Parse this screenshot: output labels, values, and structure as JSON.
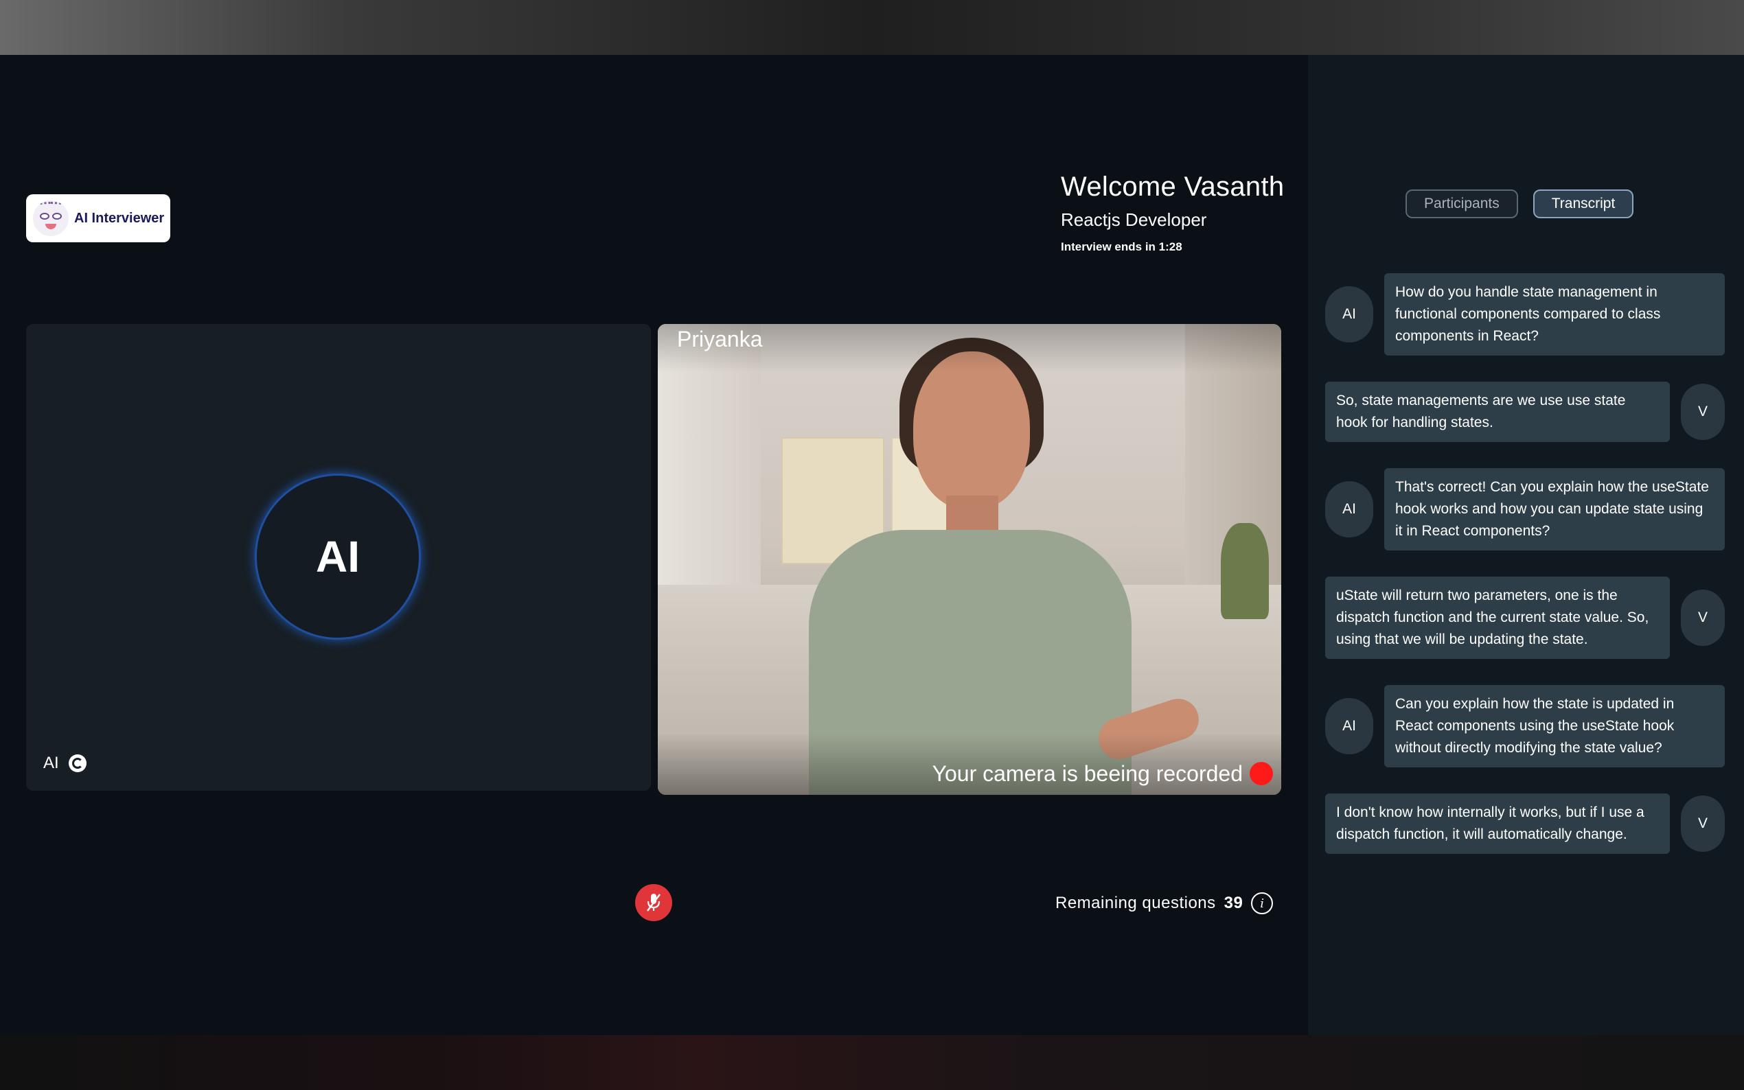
{
  "app": {
    "logo_text": "AI Interviewer"
  },
  "header": {
    "welcome": "Welcome Vasanth",
    "role": "Reactjs Developer",
    "timer": "Interview ends in 1:28"
  },
  "ai_tile": {
    "avatar_text": "AI",
    "label": "AI"
  },
  "video_tile": {
    "name": "Priyanka",
    "recording_text": "Your camera is beeing recorded"
  },
  "footer": {
    "remaining_label": "Remaining questions",
    "remaining_count": "39",
    "info_symbol": "i"
  },
  "sidebar": {
    "tabs": [
      {
        "label": "Participants",
        "active": false
      },
      {
        "label": "Transcript",
        "active": true
      }
    ],
    "transcript": [
      {
        "speaker": "AI",
        "text": "How do you handle state management in functional components compared to class components in React?"
      },
      {
        "speaker": "V",
        "text": "So, state managements are we use use state hook for handling states."
      },
      {
        "speaker": "AI",
        "text": "That's correct! Can you explain how the useState hook works and how you can update state using it in React components?"
      },
      {
        "speaker": "V",
        "text": "uState will return two parameters, one is the dispatch function and the current state value. So, using that we will be updating the state."
      },
      {
        "speaker": "AI",
        "text": "Can you explain how the state is updated in React components using the useState hook without directly modifying the state value?"
      },
      {
        "speaker": "V",
        "text": "I don't know how internally it works, but if I use a dispatch function, it will automatically change."
      }
    ]
  },
  "colors": {
    "accent_ring": "#1f4f9e",
    "mic_button": "#e0363a",
    "record_dot": "#ff1a1a",
    "bubble": "#2e3e49"
  },
  "icons": {
    "mic": "mic-off-icon",
    "info": "info-icon",
    "speaking": "speaking-indicator-icon",
    "record": "record-dot-icon"
  }
}
